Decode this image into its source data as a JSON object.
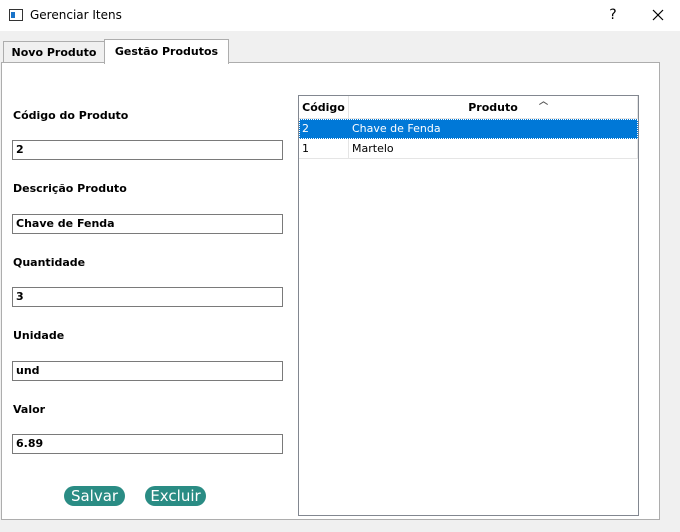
{
  "window": {
    "title": "Gerenciar Itens",
    "help_label": "?",
    "icon": "window-app-icon",
    "close_icon": "close-icon"
  },
  "tabs": [
    {
      "label": "Novo Produto",
      "active": false
    },
    {
      "label": "Gestão Produtos",
      "active": true
    }
  ],
  "form": {
    "codigo_label": "Código do Produto",
    "codigo_value": "2",
    "descricao_label": "Descrição Produto",
    "descricao_value": "Chave de Fenda",
    "quantidade_label": "Quantidade",
    "quantidade_value": "3",
    "unidade_label": "Unidade",
    "unidade_value": "und",
    "valor_label": "Valor",
    "valor_value": "6.89"
  },
  "buttons": {
    "salvar": "Salvar",
    "excluir": "Excluir",
    "accent": "#2a8c84"
  },
  "table": {
    "columns": [
      "Código",
      "Produto"
    ],
    "rows": [
      {
        "codigo": "2",
        "produto": "Chave de Fenda",
        "selected": true
      },
      {
        "codigo": "1",
        "produto": "Martelo",
        "selected": false
      }
    ],
    "selection_color": "#0078d7"
  }
}
